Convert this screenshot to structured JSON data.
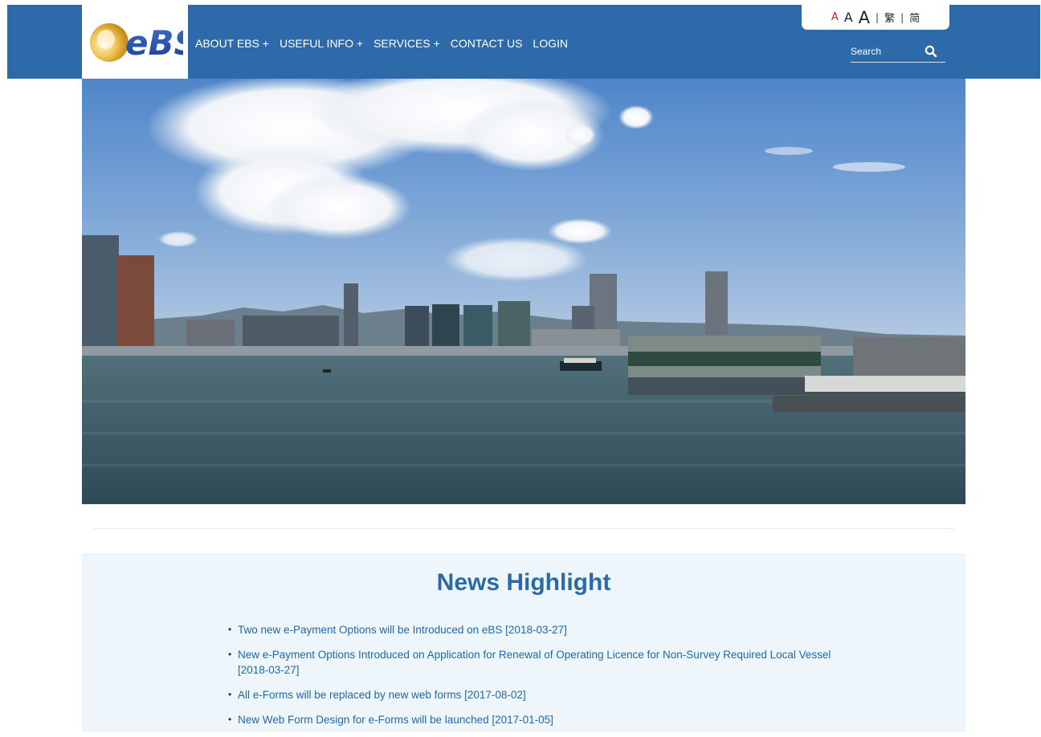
{
  "header": {
    "logo_text": "eBS",
    "nav": [
      "ABOUT EBS +",
      "USEFUL INFO +",
      "SERVICES +",
      "CONTACT US",
      "LOGIN"
    ],
    "font_sizes": [
      "A",
      "A",
      "A"
    ],
    "lang_trad": "繁",
    "lang_simp": "简",
    "separator": "|",
    "search_placeholder": "Search"
  },
  "news": {
    "title": "News Highlight",
    "items": [
      "Two new e-Payment Options will be Introduced on eBS [2018-03-27]",
      "New e-Payment Options Introduced on Application for Renewal of Operating Licence for Non-Survey Required Local Vessel [2018-03-27]",
      "All e-Forms will be replaced by new web forms [2017-08-02]",
      "New Web Form Design for e-Forms will be launched [2017-01-05]"
    ]
  },
  "colors": {
    "header_bg": "#2e6aa9",
    "news_title": "#2b6aa6",
    "news_link": "#1f67ad",
    "news_bg": "#eef6fc"
  }
}
